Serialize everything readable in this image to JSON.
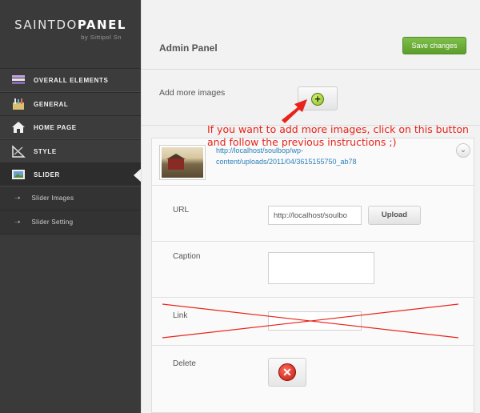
{
  "logo": {
    "brand_light": "SAINTDO",
    "brand_bold": "PANEL",
    "byline": "by Sittipol Sn"
  },
  "sidebar": {
    "items": [
      {
        "label": "OVERALL ELEMENTS",
        "icon": "overall-elements-icon"
      },
      {
        "label": "GENERAL",
        "icon": "general-icon"
      },
      {
        "label": "HOME PAGE",
        "icon": "home-icon"
      },
      {
        "label": "STYLE",
        "icon": "style-icon"
      },
      {
        "label": "SLIDER",
        "icon": "slider-icon",
        "active": true
      }
    ],
    "subitems": [
      {
        "label": "Slider Images"
      },
      {
        "label": "Slider Setting"
      }
    ]
  },
  "header": {
    "title": "Admin Panel",
    "save_label": "Save changes"
  },
  "add_images": {
    "label": "Add more images"
  },
  "annotation": {
    "text": "If you want to add more images, click on this button and follow the previous instructions ;)"
  },
  "slide": {
    "url_text": "http://localhost/soulbop/wp-content/uploads/2011/04/3615155750_ab78",
    "fields": {
      "url_label": "URL",
      "url_value": "http://localhost/soulbo",
      "upload_label": "Upload",
      "caption_label": "Caption",
      "link_label": "Link",
      "delete_label": "Delete"
    }
  },
  "colors": {
    "accent_green": "#6aad35",
    "annotation_red": "#e8241a",
    "link_blue": "#2a80b9",
    "sidebar_bg": "#3a3a3a"
  }
}
